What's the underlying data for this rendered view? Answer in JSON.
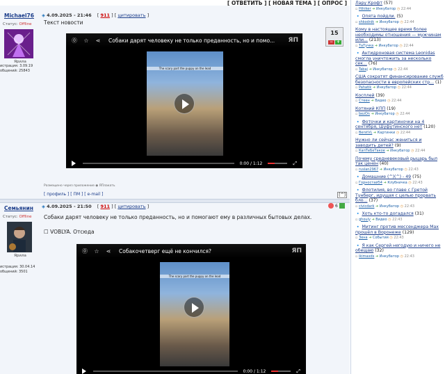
{
  "topbar": {
    "label": "[ ОТВЕТИТЬ ] [ НОВАЯ ТЕМА ] [ ОПРОС ]"
  },
  "posts": [
    {
      "author": "Michael76",
      "status_label": "Статус:",
      "status": "Offline",
      "rank": "Ярила",
      "reg": "истрация: 3.09.19",
      "msgs": "общений: 25843",
      "date": "4.09.2025 - 21:46",
      "num": "911",
      "quote": "цитировать",
      "text": "Текст новости",
      "rating": "15",
      "video_title": "Собаки дарят человеку не только преданность, но и помо...",
      "video_caption": "The scary part the puppy on the lead",
      "time": "0:00 / 1:12",
      "signature": "Размещено через приложение ◉ ЯПлакать",
      "footer": "[ профиль ] [ ПМ ] [ e-mail ]"
    },
    {
      "author": "Семьянин",
      "status_label": "Статус:",
      "status": "Offline",
      "rank": "Ярила",
      "reg": "истрация: 30.04.14",
      "msgs": "общений: 3501",
      "date": "4.09.2025 - 21:50",
      "num": "911",
      "quote": "цитировать",
      "text": "Собаки дарят человеку не только преданность, но и помогают ему в различных бытовых делах.",
      "text2": "☐ VOBLYA. Отсюда",
      "votes": "6",
      "video_title": "Собакочетверг ещё не кончился?",
      "video_caption": "The scary part the puppy on the lead",
      "time": "0:00 / 1:12"
    }
  ],
  "sidebar": [
    {
      "title": "Лару Крофт",
      "count": "(57)",
      "user": "Hihiker",
      "section": "Инкубатор",
      "time": "22:44"
    },
    {
      "title": "Опята пойдли.",
      "count": "(5)",
      "drop": true,
      "user": "shkodnik",
      "section": "Инкубатор",
      "time": "22:44"
    },
    {
      "title": "Кому в настоящее время более необходимы отношения — мужчинам или...",
      "count": "(213)",
      "user": "ТаТучка",
      "section": "Инкубатор",
      "time": "22:44"
    },
    {
      "title": "Антидроновая система Leonidas смогла уничтожить за несколько сек...",
      "count": "(76)",
      "drop": true,
      "user": "Tabaj",
      "section": "Инкубатор",
      "time": "22:44"
    },
    {
      "title": "США сократят финансирование служб безопасности в европейских стр...",
      "count": "(1)",
      "user": "Pahatik",
      "section": "Инкубатор",
      "time": "22:44"
    },
    {
      "title": "Косплей",
      "count": "(39)",
      "user": "Стеен",
      "section": "Видео",
      "time": "22:44"
    },
    {
      "title": "Котяний КПП",
      "count": "(19)",
      "user": "bezOn",
      "section": "Инкубатор",
      "time": "22:44"
    },
    {
      "title": "Фоточки и картиночки на 4 сентября, Шуфутинского нет",
      "count": "(120)",
      "drop": true,
      "user": "BerstVL",
      "section": "Картинки",
      "time": "22:44"
    },
    {
      "title": "Нужно ли сейчас жениться и заводить детей?",
      "count": "(9)",
      "user": "КапТеБеТакое",
      "section": "Инкубатор",
      "time": "22:44"
    },
    {
      "title": "Почему средневековый рыцарь был так ценен",
      "count": "(40)",
      "user": "ruslan2967",
      "section": "Инкубатор",
      "time": "22:43"
    },
    {
      "title": "Домашние (^)(^) - 49",
      "count": "(75)",
      "drop": true,
      "user": "Горностай54",
      "section": "Клубничка",
      "time": "22:43"
    },
    {
      "title": "Флотилия, во главе с Гретой Тунберг, идущая с целью прорвать бло...",
      "count": "(37)",
      "drop": true,
      "user": "civicdark",
      "section": "Инкубатор",
      "time": "22:43"
    },
    {
      "title": "Хоть кто-то догадался",
      "count": "(31)",
      "drop": true,
      "user": "ghouly",
      "section": "Видео",
      "time": "22:43"
    },
    {
      "title": "Митинг против мессенджера Max прошёл в Воронеже",
      "count": "(129)",
      "drop": true,
      "user": "Зена",
      "section": "События",
      "time": "22:43"
    },
    {
      "title": "Я как Сергей негодую и ничего не обещаю",
      "count": "(32)",
      "drop": true,
      "user": "ikimaxds",
      "section": "Инкубатор",
      "time": "22:43"
    }
  ]
}
